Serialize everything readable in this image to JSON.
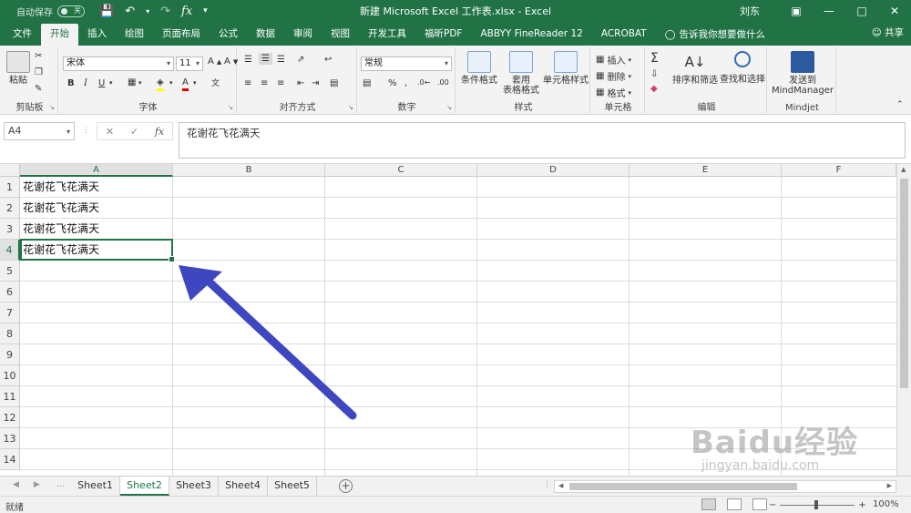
{
  "titlebar": {
    "autosave_label": "自动保存",
    "autosave_state": "关",
    "window_title": "新建 Microsoft Excel 工作表.xlsx - Excel",
    "user": "刘东"
  },
  "tabs": [
    "文件",
    "开始",
    "插入",
    "绘图",
    "页面布局",
    "公式",
    "数据",
    "审阅",
    "视图",
    "开发工具",
    "福昕PDF",
    "ABBYY FineReader 12",
    "ACROBAT"
  ],
  "active_tab": "开始",
  "tell_me": "告诉我你想要做什么",
  "share": "共享",
  "ribbon": {
    "clipboard": {
      "paste": "粘贴",
      "label": "剪贴板"
    },
    "font": {
      "name": "宋体",
      "size": "11",
      "bold": "B",
      "italic": "I",
      "underline": "U",
      "label": "字体"
    },
    "alignment": {
      "label": "对齐方式"
    },
    "number": {
      "format": "常规",
      "label": "数字"
    },
    "styles": {
      "conditional": "条件格式",
      "table_format_1": "套用",
      "table_format_2": "表格格式",
      "cell_styles": "单元格样式",
      "label": "样式"
    },
    "cells": {
      "insert": "插入",
      "delete": "删除",
      "format": "格式",
      "label": "单元格"
    },
    "editing": {
      "sort": "排序和筛选",
      "find": "查找和选择",
      "label": "编辑"
    },
    "mindjet": {
      "send_1": "发送到",
      "send_2": "MindManager",
      "label": "Mindjet"
    }
  },
  "formula_bar": {
    "name_box": "A4",
    "fx": "fx",
    "content": "花谢花飞花满天"
  },
  "grid": {
    "columns": [
      "A",
      "B",
      "C",
      "D",
      "E",
      "F"
    ],
    "rows": [
      "1",
      "2",
      "3",
      "4",
      "5",
      "6",
      "7",
      "8",
      "9",
      "10",
      "11",
      "12",
      "13",
      "14"
    ],
    "cells": [
      {
        "ref": "A1",
        "value": "花谢花飞花满天"
      },
      {
        "ref": "A2",
        "value": "花谢花飞花满天"
      },
      {
        "ref": "A3",
        "value": "花谢花飞花满天"
      },
      {
        "ref": "A4",
        "value": "花谢花飞花满天"
      }
    ],
    "active_cell": "A4",
    "annotation_color": "#3f47c0"
  },
  "sheets": [
    "Sheet1",
    "Sheet2",
    "Sheet3",
    "Sheet4",
    "Sheet5"
  ],
  "active_sheet": "Sheet2",
  "status": {
    "ready": "就绪",
    "zoom": "100%"
  },
  "watermark": {
    "brand": "Baidu经验",
    "url": "jingyan.baidu.com"
  },
  "colors": {
    "excel_green": "#217346",
    "ribbon_bg": "#f3f3f3"
  }
}
